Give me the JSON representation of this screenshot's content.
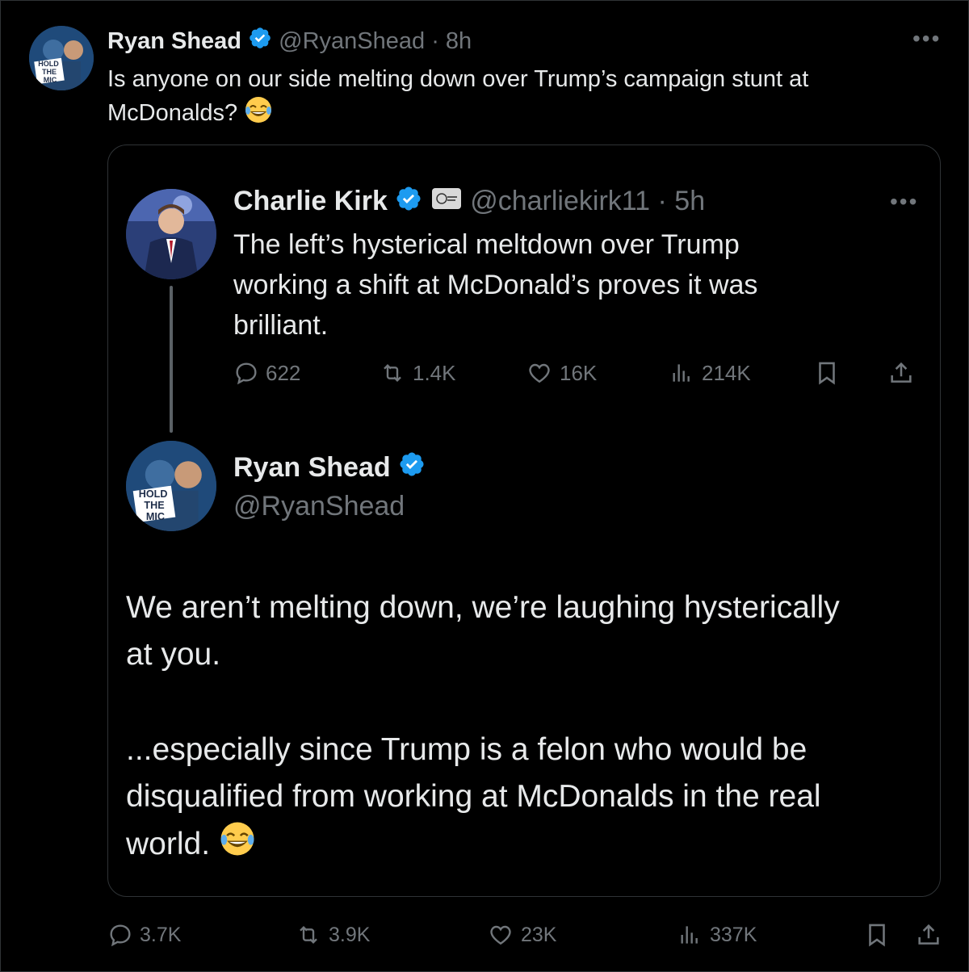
{
  "outer_tweet": {
    "author_name": "Ryan Shead",
    "handle": "@RyanShead",
    "time": "8h",
    "text": "Is anyone on our side melting down over Trump’s campaign stunt at McDonalds?",
    "avatar_text": [
      "HOLD",
      "THE",
      "MIC"
    ],
    "stats": {
      "replies": "3.7K",
      "reposts": "3.9K",
      "likes": "23K",
      "views": "337K"
    }
  },
  "quoted_parent": {
    "author_name": "Charlie Kirk",
    "handle": "@charliekirk11",
    "time": "5h",
    "text_line1": "The left’s hysterical meltdown over Trump",
    "text_line2": "working a shift at McDonald’s proves it was",
    "text_line3": "brilliant.",
    "stats": {
      "replies": "622",
      "reposts": "1.4K",
      "likes": "16K",
      "views": "214K"
    }
  },
  "quoted_reply": {
    "author_name": "Ryan Shead",
    "handle": "@RyanShead",
    "avatar_text": [
      "HOLD",
      "THE",
      "MIC"
    ],
    "para1_line1": "We aren’t melting down, we’re laughing hysterically",
    "para1_line2": "at you.",
    "para2_line1": "...especially since Trump is a felon who would be",
    "para2_line2": "disqualified from working at McDonalds in the real",
    "para2_line3": "world."
  },
  "colors": {
    "background": "#000000",
    "text": "#e7e9ea",
    "muted": "#71767b",
    "border": "#2f3336",
    "verified": "#1d9bf0"
  }
}
